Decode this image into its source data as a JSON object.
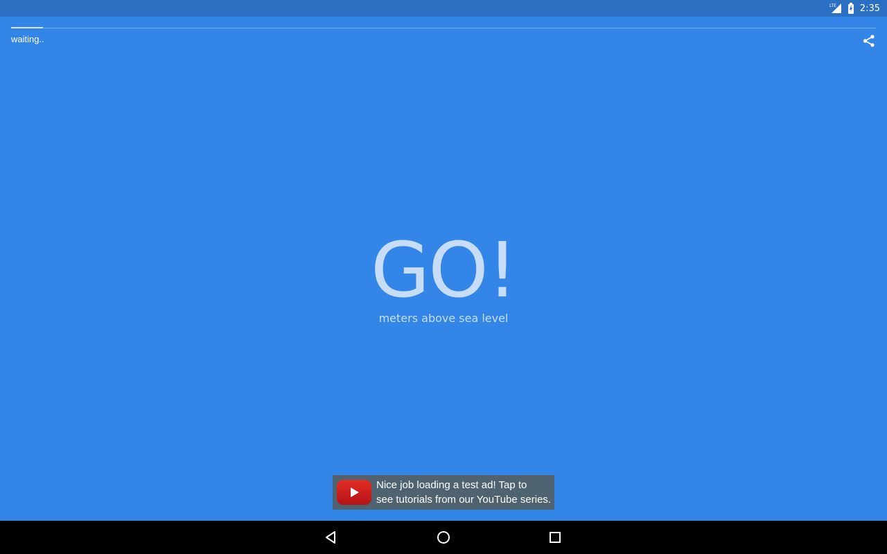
{
  "status_bar": {
    "time": "2:35",
    "network_label": "LTE",
    "icons": [
      "signal-icon",
      "battery-icon"
    ]
  },
  "progress": {
    "fraction": 0.037
  },
  "header": {
    "status_text": "waiting..",
    "share_icon": "share-icon"
  },
  "readout": {
    "value": "GO!",
    "unit": "meters above sea level"
  },
  "ad": {
    "line1": "Nice job loading a test ad!  Tap to",
    "line2": "see tutorials from our YouTube series.",
    "icon": "youtube-logo-icon"
  },
  "nav": {
    "icons": [
      "back-icon",
      "home-icon",
      "recents-icon"
    ]
  },
  "colors": {
    "background": "#3386e8",
    "status_bar": "#2b6fc2",
    "text_light": "#c7ddf7",
    "ad_background": "#4f6270"
  }
}
